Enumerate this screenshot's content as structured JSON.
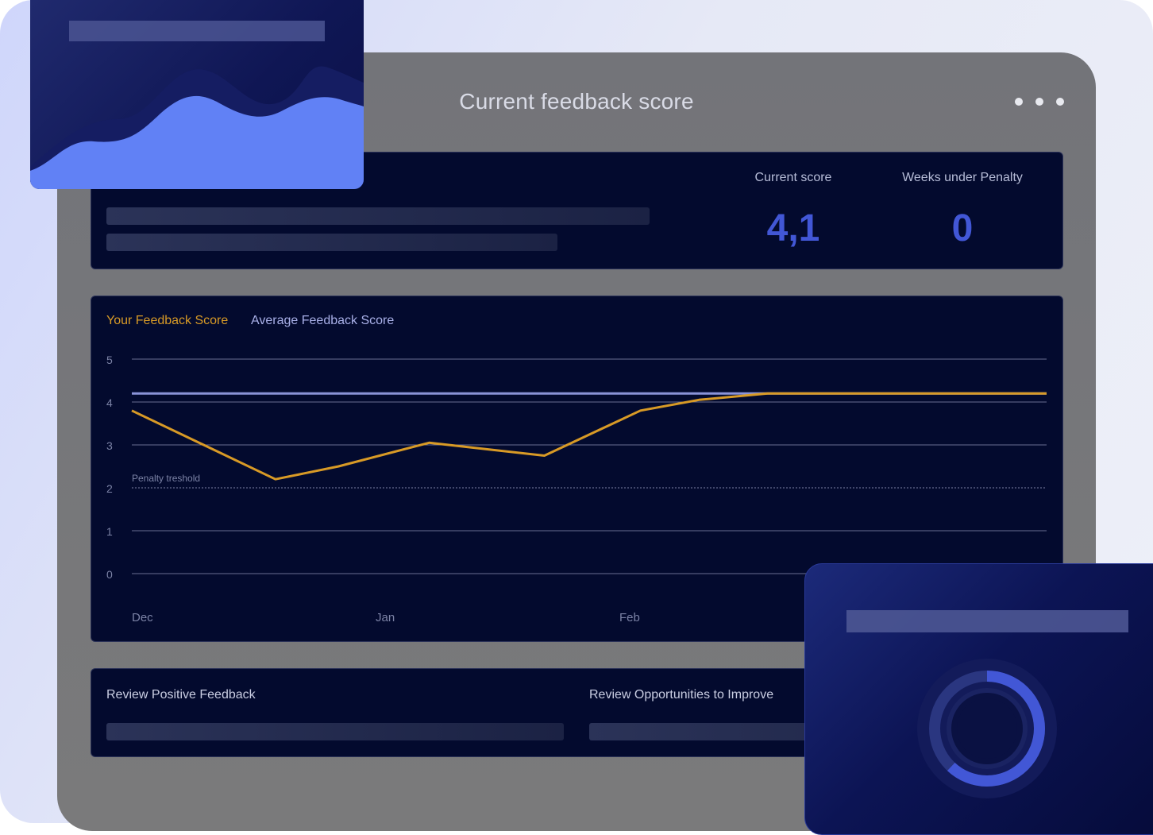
{
  "header": {
    "title": "Current feedback score"
  },
  "summary": {
    "current_score_label": "Current score",
    "current_score_value": "4,1",
    "weeks_penalty_label": "Weeks under Penalty",
    "weeks_penalty_value": "0"
  },
  "chart": {
    "legend_yours": "Your Feedback Score",
    "legend_average": "Average Feedback Score",
    "penalty_label": "Penalty treshold",
    "y_ticks": [
      "5",
      "4",
      "3",
      "2",
      "1",
      "0"
    ],
    "x_ticks": [
      "Dec",
      "Jan",
      "Feb"
    ]
  },
  "chart_data": {
    "type": "line",
    "ylim": [
      0,
      5
    ],
    "x": [
      "Dec",
      "",
      "",
      "",
      "Jan",
      "",
      "",
      "Feb",
      "",
      "",
      "",
      "",
      "",
      ""
    ],
    "series": [
      {
        "name": "Your Feedback Score",
        "color": "#d89a26",
        "values": [
          3.8,
          2.2,
          2.5,
          3.05,
          2.75,
          3.8,
          4.05,
          4.2,
          4.2,
          4.2,
          4.2,
          4.2
        ]
      },
      {
        "name": "Average Feedback Score",
        "color": "#8a93d8",
        "values": [
          4.2,
          4.2
        ]
      }
    ],
    "penalty_threshold": 2,
    "grid": true
  },
  "review": {
    "positive_label": "Review Positive Feedback",
    "opportunities_label": "Review  Opportunities to Improve"
  },
  "colors": {
    "accent": "#4257d6",
    "your_score": "#d89a26",
    "average": "#8a93d8",
    "card_bg": "#030a2e"
  },
  "donut": {
    "progress": 0.62
  }
}
